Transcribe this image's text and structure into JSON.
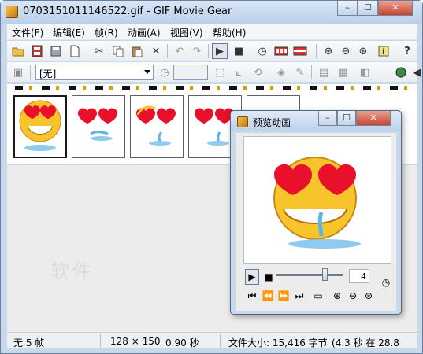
{
  "window": {
    "title": "0703151011146522.gif - GIF Movie Gear",
    "icon": "gif-movie-gear-icon",
    "caption_buttons": [
      "minimize",
      "maximize",
      "close"
    ]
  },
  "menu": {
    "items": [
      "文件(F)",
      "编辑(E)",
      "帧(R)",
      "动画(A)",
      "视图(V)",
      "帮助(H)"
    ]
  },
  "toolbar1": {
    "icons": [
      "open-folder",
      "film-strip",
      "save",
      "new-page",
      "cut",
      "copy",
      "paste",
      "delete",
      "undo",
      "redo",
      "play",
      "stop",
      "timing-clock",
      "palette",
      "transparency",
      "zoom-in",
      "zoom-out",
      "zoom-fit",
      "info",
      "help"
    ]
  },
  "toolbar2": {
    "combo_value": "[无]",
    "delay_value": ""
  },
  "frames": {
    "count": 5,
    "selected_index": 0
  },
  "status": {
    "frames": "无 5 帧",
    "dimensions": "128 × 150",
    "duration": "0.90 秒",
    "filesize": "文件大小: 15,416 字节",
    "download": "(4.3 秒 在 28.8"
  },
  "preview_window": {
    "title": "预览动画",
    "frame_number": "4",
    "slider_position": 0.72,
    "controls": [
      "play",
      "stop",
      "first-frame",
      "prev-frame",
      "next-frame",
      "last-frame",
      "screen",
      "zoom-in",
      "zoom-out",
      "zoom-fit",
      "timing"
    ]
  },
  "watermark": "软件"
}
